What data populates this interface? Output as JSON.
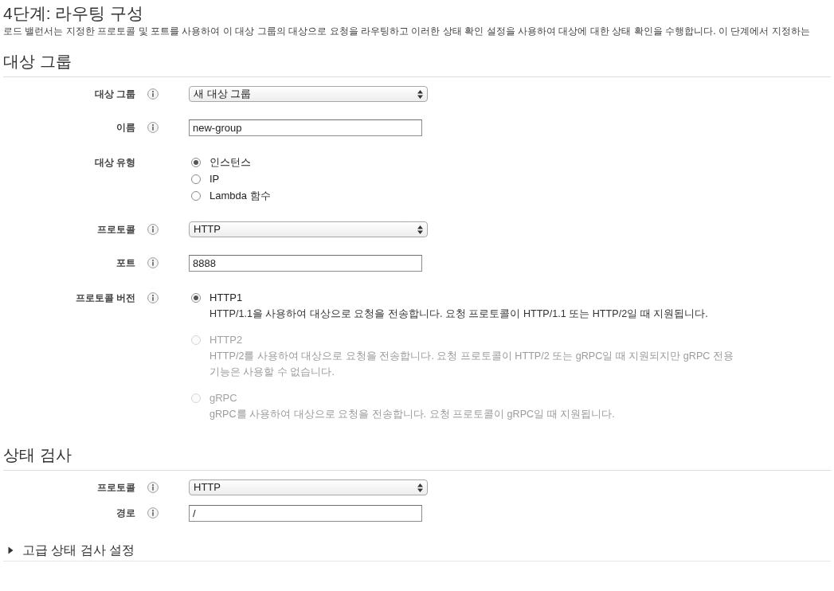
{
  "page": {
    "title": "4단계: 라우팅 구성",
    "description": "로드 밸런서는 지정한 프로토콜 및 포트를 사용하여 이 대상 그룹의 대상으로 요청을 라우팅하고 이러한 상태 확인 설정을 사용하여 대상에 대한 상태 확인을 수행합니다. 이 단계에서 지정하는"
  },
  "sections": [
    {
      "heading": "대상 그룹",
      "fields": [
        {
          "kind": "select",
          "label": "대상 그룹",
          "info": true,
          "value": "새 대상 그룹"
        },
        {
          "kind": "text",
          "label": "이름",
          "info": true,
          "value": "new-group"
        },
        {
          "kind": "radio",
          "label": "대상 유형",
          "info": false,
          "options": [
            {
              "label": "인스턴스",
              "selected": true,
              "disabled": false
            },
            {
              "label": "IP",
              "selected": false,
              "disabled": false
            },
            {
              "label": "Lambda 함수",
              "selected": false,
              "disabled": false
            }
          ]
        },
        {
          "kind": "select",
          "label": "프로토콜",
          "info": true,
          "value": "HTTP"
        },
        {
          "kind": "text",
          "label": "포트",
          "info": true,
          "value": "8888"
        },
        {
          "kind": "radio",
          "label": "프로토콜 버전",
          "info": true,
          "options": [
            {
              "label": "HTTP1",
              "description": "HTTP/1.1을 사용하여 대상으로 요청을 전송합니다. 요청 프로토콜이 HTTP/1.1 또는 HTTP/2일 때 지원됩니다.",
              "selected": true,
              "disabled": false
            },
            {
              "label": "HTTP2",
              "description": "HTTP/2를 사용하여 대상으로 요청을 전송합니다. 요청 프로토콜이 HTTP/2 또는 gRPC일 때 지원되지만 gRPC 전용 기능은 사용할 수 없습니다.",
              "selected": false,
              "disabled": true
            },
            {
              "label": "gRPC",
              "description": "gRPC를 사용하여 대상으로 요청을 전송합니다. 요청 프로토콜이 gRPC일 때 지원됩니다.",
              "selected": false,
              "disabled": true
            }
          ]
        }
      ]
    },
    {
      "heading": "상태 검사",
      "fields": [
        {
          "kind": "select",
          "label": "프로토콜",
          "info": true,
          "value": "HTTP"
        },
        {
          "kind": "text",
          "label": "경로",
          "info": true,
          "value": "/"
        }
      ]
    }
  ],
  "advanced": {
    "label": "고급 상태 검사 설정",
    "expanded": false
  }
}
